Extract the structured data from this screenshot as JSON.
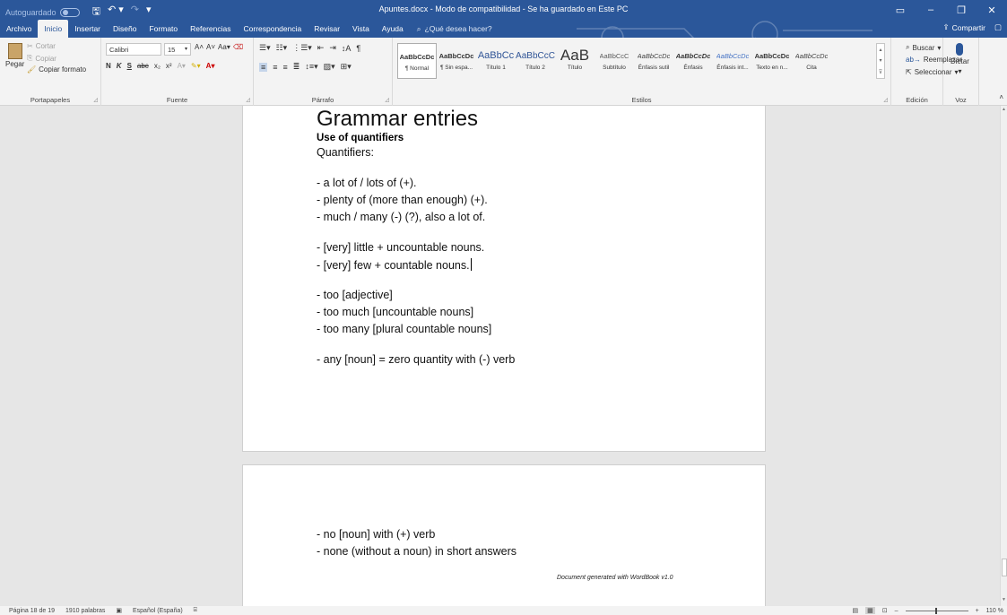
{
  "titlebar": {
    "autosave_label": "Autoguardado",
    "autosave_state": "Desactivado",
    "doc_title": "Apuntes.docx  -  Modo de compatibilidad  -  Se ha guardado en Este PC",
    "icons": [
      "save-icon",
      "undo-icon",
      "redo-icon",
      "customize-qat-icon"
    ]
  },
  "tabs": [
    "Archivo",
    "Inicio",
    "Insertar",
    "Diseño",
    "Formato",
    "Referencias",
    "Correspondencia",
    "Revisar",
    "Vista",
    "Ayuda"
  ],
  "active_tab": "Inicio",
  "tell_me": "¿Qué desea hacer?",
  "share_label": "Compartir",
  "ribbon": {
    "clipboard": {
      "paste": "Pegar",
      "cut": "Cortar",
      "copy": "Copiar",
      "format_painter": "Copiar formato",
      "label": "Portapapeles"
    },
    "font": {
      "name": "Calibri",
      "size": "15",
      "label": "Fuente",
      "bold": "N",
      "italic": "K",
      "underline": "S"
    },
    "paragraph": {
      "label": "Párrafo"
    },
    "styles": {
      "label": "Estilos",
      "items": [
        {
          "preview": "AaBbCcDc",
          "name": "¶ Normal",
          "selected": true
        },
        {
          "preview": "AaBbCcDc",
          "name": "¶ Sin espa..."
        },
        {
          "preview": "AaBbCc",
          "name": "Título 1"
        },
        {
          "preview": "AaBbCcC",
          "name": "Título 2"
        },
        {
          "preview": "AaB",
          "name": "Título"
        },
        {
          "preview": "AaBbCcC",
          "name": "Subtítulo"
        },
        {
          "preview": "AaBbCcDc",
          "name": "Énfasis sutil"
        },
        {
          "preview": "AaBbCcDc",
          "name": "Énfasis"
        },
        {
          "preview": "AaBbCcDc",
          "name": "Énfasis int..."
        },
        {
          "preview": "AaBbCcDc",
          "name": "Texto en n..."
        },
        {
          "preview": "AaBbCcDc",
          "name": "Cita"
        }
      ]
    },
    "editing": {
      "find": "Buscar",
      "replace": "Reemplazar",
      "select": "Seleccionar",
      "label": "Edición"
    },
    "voice": {
      "dictate": "Dictar",
      "label": "Voz"
    }
  },
  "document": {
    "title": "Grammar entries",
    "subtitle": "Use of quantifiers",
    "page1_lines": [
      "Quantifiers:",
      "- a lot of / lots of (+).",
      "- plenty of (more than enough) (+).",
      "- much / many (-) (?), also a lot of.",
      "- [very] little + uncountable nouns.",
      "- [very] few + countable nouns.",
      "- too [adjective]",
      "- too much [uncountable nouns]",
      "- too many [plural countable nouns]",
      "- any [noun] = zero quantity with (-) verb"
    ],
    "page2_lines": [
      "- no [noun] with (+) verb",
      "- none (without a noun) in short answers"
    ],
    "footer_note": "Document generated with WordBook v1.0"
  },
  "status": {
    "page": "Página 18 de 19",
    "words": "1910 palabras",
    "language": "Español (España)",
    "zoom": "110 %"
  }
}
